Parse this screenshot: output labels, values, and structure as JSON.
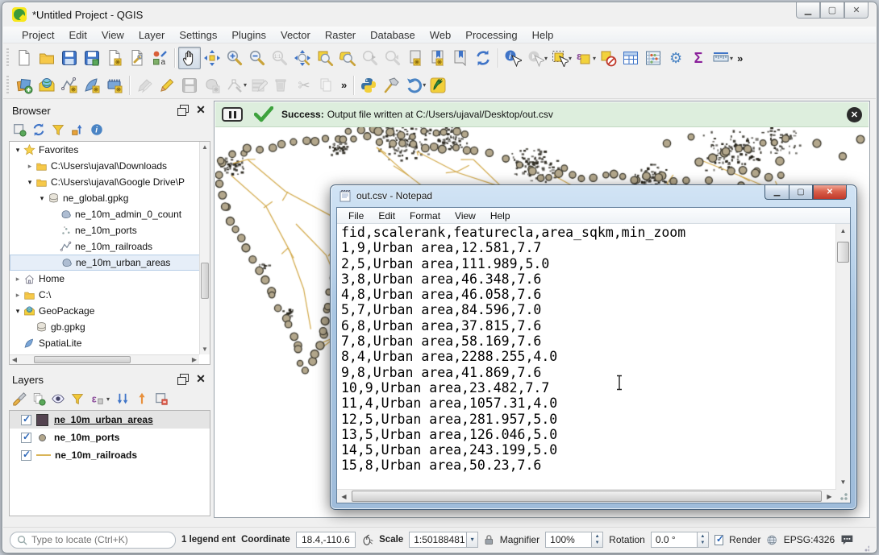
{
  "window": {
    "title": "*Untitled Project - QGIS"
  },
  "menu": {
    "items": [
      "Project",
      "Edit",
      "View",
      "Layer",
      "Settings",
      "Plugins",
      "Vector",
      "Raster",
      "Database",
      "Web",
      "Processing",
      "Help"
    ]
  },
  "message_bar": {
    "prefix": "Success:",
    "text": "Output file written at C:/Users/ujaval/Desktop/out.csv"
  },
  "browser": {
    "title": "Browser",
    "items": [
      {
        "label": "Favorites"
      },
      {
        "label": "C:\\Users\\ujaval\\Downloads"
      },
      {
        "label": "C:\\Users\\ujaval\\Google Drive\\P"
      },
      {
        "label": "ne_global.gpkg"
      },
      {
        "label": "ne_10m_admin_0_count"
      },
      {
        "label": "ne_10m_ports"
      },
      {
        "label": "ne_10m_railroads"
      },
      {
        "label": "ne_10m_urban_areas"
      },
      {
        "label": "Home"
      },
      {
        "label": "C:\\"
      },
      {
        "label": "GeoPackage"
      },
      {
        "label": "gb.gpkg"
      },
      {
        "label": "SpatiaLite"
      }
    ]
  },
  "layers": {
    "title": "Layers",
    "items": [
      {
        "label": "ne_10m_urban_areas",
        "checked": true
      },
      {
        "label": "ne_10m_ports",
        "checked": true
      },
      {
        "label": "ne_10m_railroads",
        "checked": true
      }
    ]
  },
  "notepad": {
    "title": "out.csv - Notepad",
    "menu": [
      "File",
      "Edit",
      "Format",
      "View",
      "Help"
    ],
    "csv_text": "fid,scalerank,featurecla,area_sqkm,min_zoom\n1,9,Urban area,12.581,7.7\n2,5,Urban area,111.989,5.0\n3,8,Urban area,46.348,7.6\n4,8,Urban area,46.058,7.6\n5,7,Urban area,84.596,7.0\n6,8,Urban area,37.815,7.6\n7,8,Urban area,58.169,7.6\n8,4,Urban area,2288.255,4.0\n9,8,Urban area,41.869,7.6\n10,9,Urban area,23.482,7.7\n11,4,Urban area,1057.31,4.0\n12,5,Urban area,281.957,5.0\n13,5,Urban area,126.046,5.0\n14,5,Urban area,243.199,5.0\n15,8,Urban area,50.23,7.6"
  },
  "statusbar": {
    "locate_placeholder": "Type to locate (Ctrl+K)",
    "legend_text": "1 legend ent",
    "coordinate_label": "Coordinate",
    "coordinate_value": "18.4,-110.6",
    "scale_label": "Scale",
    "scale_value": "1:50188481",
    "magnifier_label": "Magnifier",
    "magnifier_value": "100%",
    "rotation_label": "Rotation",
    "rotation_value": "0.0 °",
    "render_label": "Render",
    "epsg_text": "EPSG:4326"
  },
  "map": {
    "port_fill": "#b3a78c",
    "port_stroke": "#3c392e",
    "railroad_color": "#d2a94a",
    "urban_color": "#26231a"
  }
}
